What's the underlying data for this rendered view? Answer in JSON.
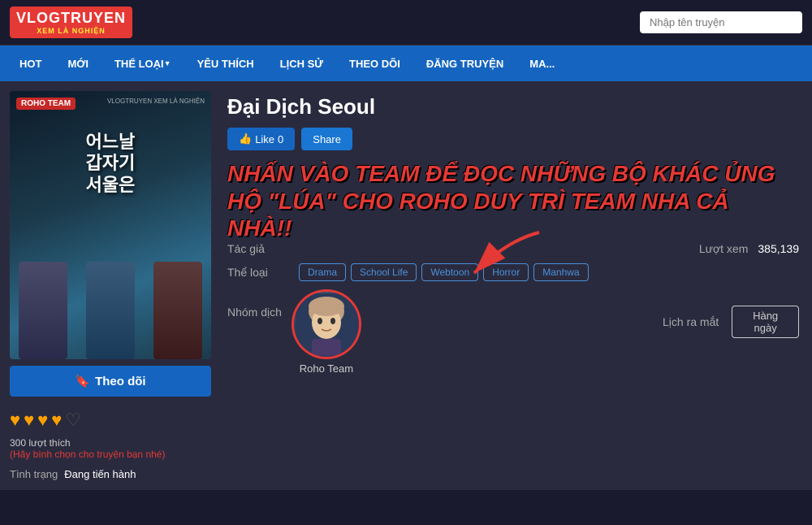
{
  "header": {
    "logo_main": "VLOGTRUYEN",
    "logo_sub": "XEM LÀ NGHIỆN",
    "search_placeholder": "Nhập tên truyện"
  },
  "nav": {
    "items": [
      {
        "label": "HOT",
        "dropdown": false
      },
      {
        "label": "MỚI",
        "dropdown": false
      },
      {
        "label": "THỂ LOẠI",
        "dropdown": true
      },
      {
        "label": "YÊU THÍCH",
        "dropdown": false
      },
      {
        "label": "LỊCH SỬ",
        "dropdown": false
      },
      {
        "label": "THEO DÕI",
        "dropdown": false
      },
      {
        "label": "ĐĂNG TRUYỆN",
        "dropdown": false
      },
      {
        "label": "MA...",
        "dropdown": false
      }
    ]
  },
  "manga": {
    "title": "Đại Dịch Seoul",
    "cover_badge": "ROHO TEAM",
    "cover_title": "어느날\n갑자기\n서울은",
    "cover_watermark": "VLOGTRUYEN\nXEM LÀ NGHIỆN",
    "promo_text": "NHẤN VÀO TEAM ĐỂ ĐỌC NHỮNG BỘ KHÁC ỦNG HỘ \"LÚA\" CHO ROHO DUY TRÌ TEAM NHA CẢ NHÀ!!",
    "like_label": "Like",
    "like_count": "0",
    "share_label": "Share",
    "author_label": "Tác giả",
    "author_value": "",
    "genre_label": "Thể loại",
    "genres": [
      "Drama",
      "School Life",
      "Webtoon",
      "Horror",
      "Manhwa"
    ],
    "group_label": "Nhóm dịch",
    "team_name": "Roho Team",
    "views_label": "Lượt xem",
    "views_value": "385,139",
    "release_label": "Lịch ra mắt",
    "release_value": "Hàng ngày",
    "follow_label": "Theo dõi",
    "hearts": [
      "♥",
      "♥",
      "♥",
      "♥"
    ],
    "likes_count": "300 lượt thích",
    "likes_prompt": "(Hãy bình chọn cho truyện bạn nhé)",
    "status_label": "Tình trạng",
    "status_value": "Đang tiến hành"
  }
}
